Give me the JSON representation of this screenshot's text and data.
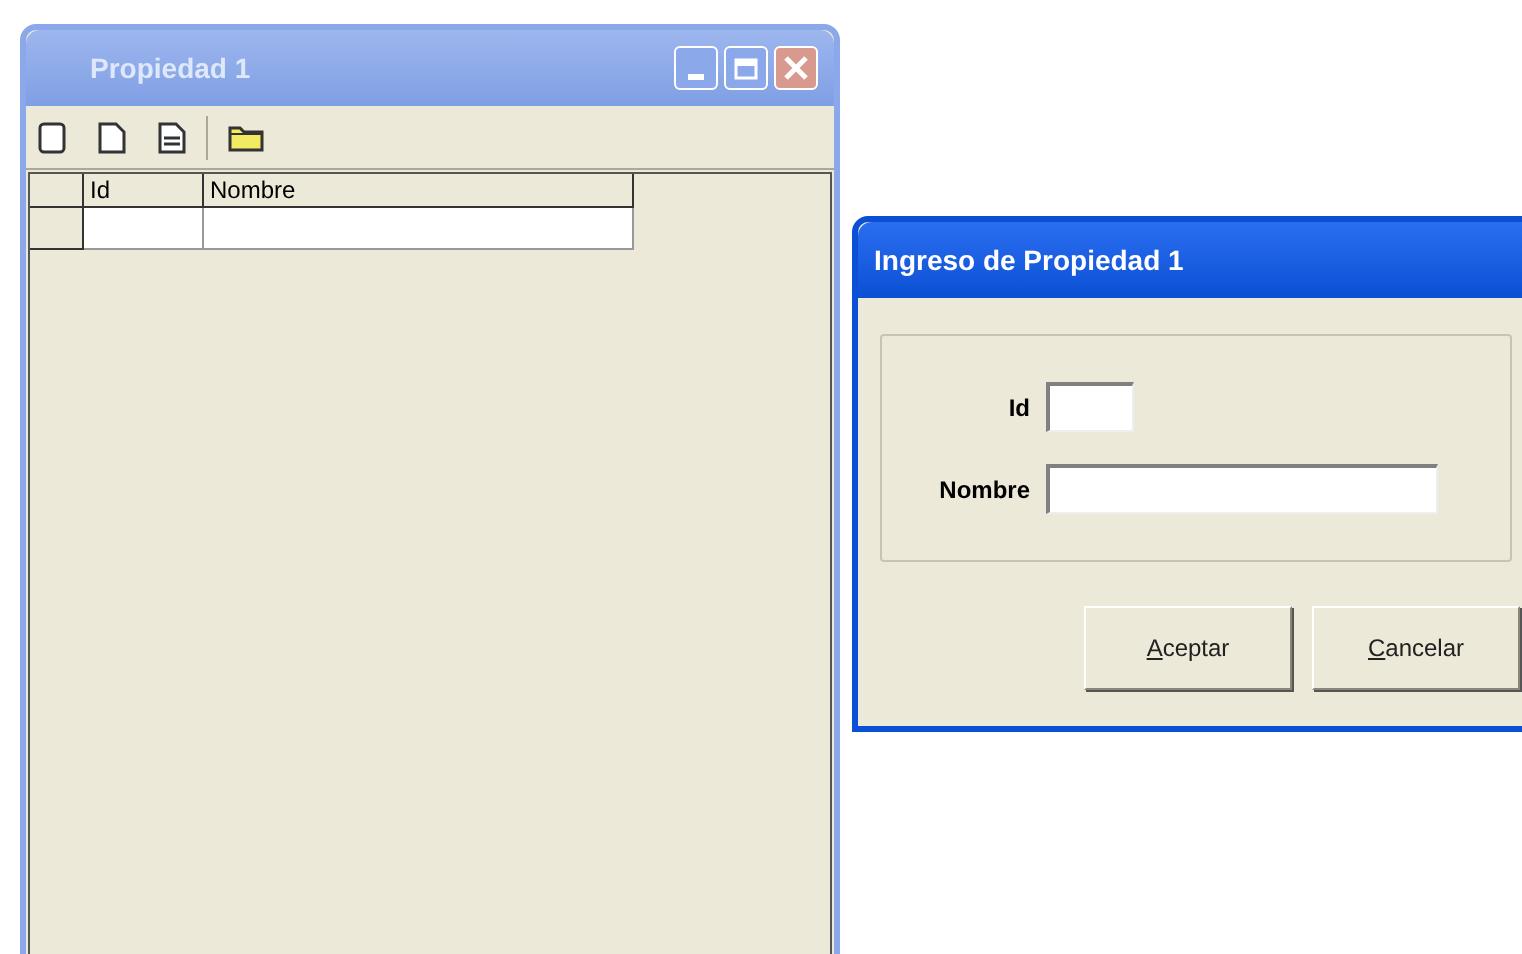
{
  "main_window": {
    "title": "Propiedad 1",
    "active": false,
    "grid": {
      "columns": [
        "Id",
        "Nombre"
      ]
    }
  },
  "dialog": {
    "title": "Ingreso de Propiedad 1",
    "active": true,
    "fields": [
      {
        "label": "Id",
        "kind": "short"
      },
      {
        "label": "Nombre",
        "kind": "long"
      }
    ],
    "buttons": [
      "Aceptar",
      "Cancelar"
    ]
  }
}
